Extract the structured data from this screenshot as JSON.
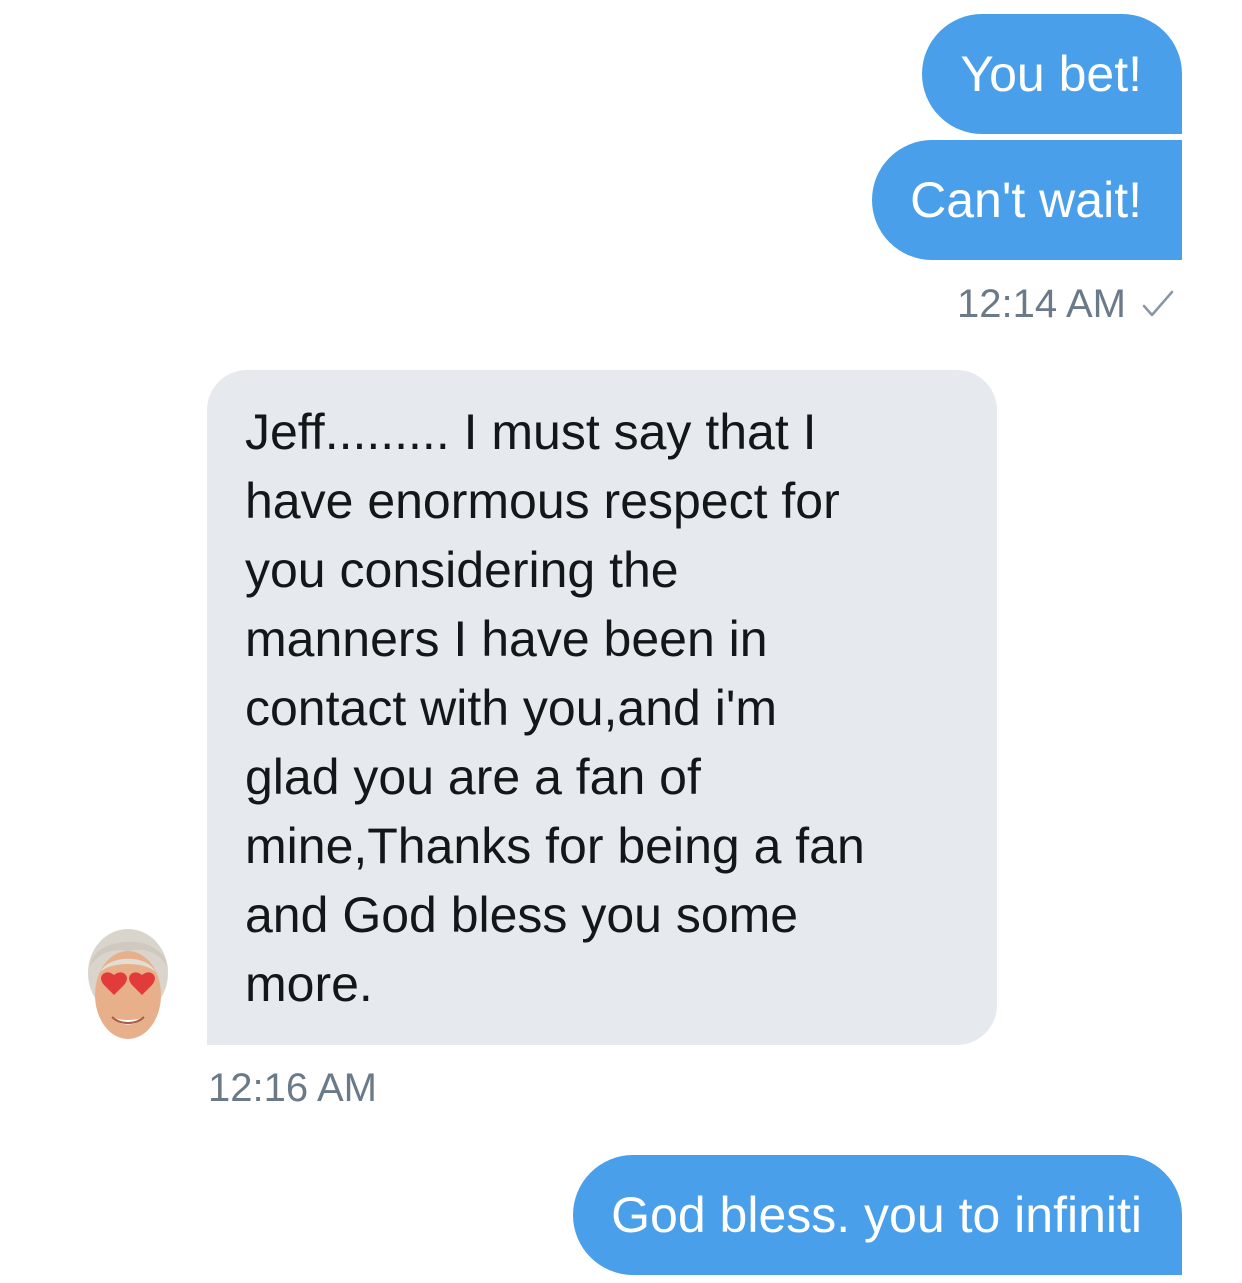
{
  "conversation": {
    "messages": [
      {
        "sender": "me",
        "text": "You bet!"
      },
      {
        "sender": "me",
        "text": "Can't wait!"
      },
      {
        "sender": "me",
        "timestamp": "12:14 AM",
        "status_icon": "check-icon"
      },
      {
        "sender": "other",
        "lines": [
          "Jeff......... I must say that I",
          "have enormous respect for",
          "you considering the",
          "manners I have been in",
          "contact with you,and i'm",
          "glad you are a fan of",
          "mine,Thanks for being a fan",
          "and God bless you some",
          "more."
        ],
        "avatar_icon": "emoji-avatar-heart-eyes-icon",
        "timestamp": "12:16 AM"
      },
      {
        "sender": "me",
        "text": "God bless. you to infiniti"
      }
    ]
  },
  "colors": {
    "outgoing_bubble": "#4a9fea",
    "incoming_bubble": "#e6eaef",
    "timestamp_text": "#6b7a88"
  }
}
